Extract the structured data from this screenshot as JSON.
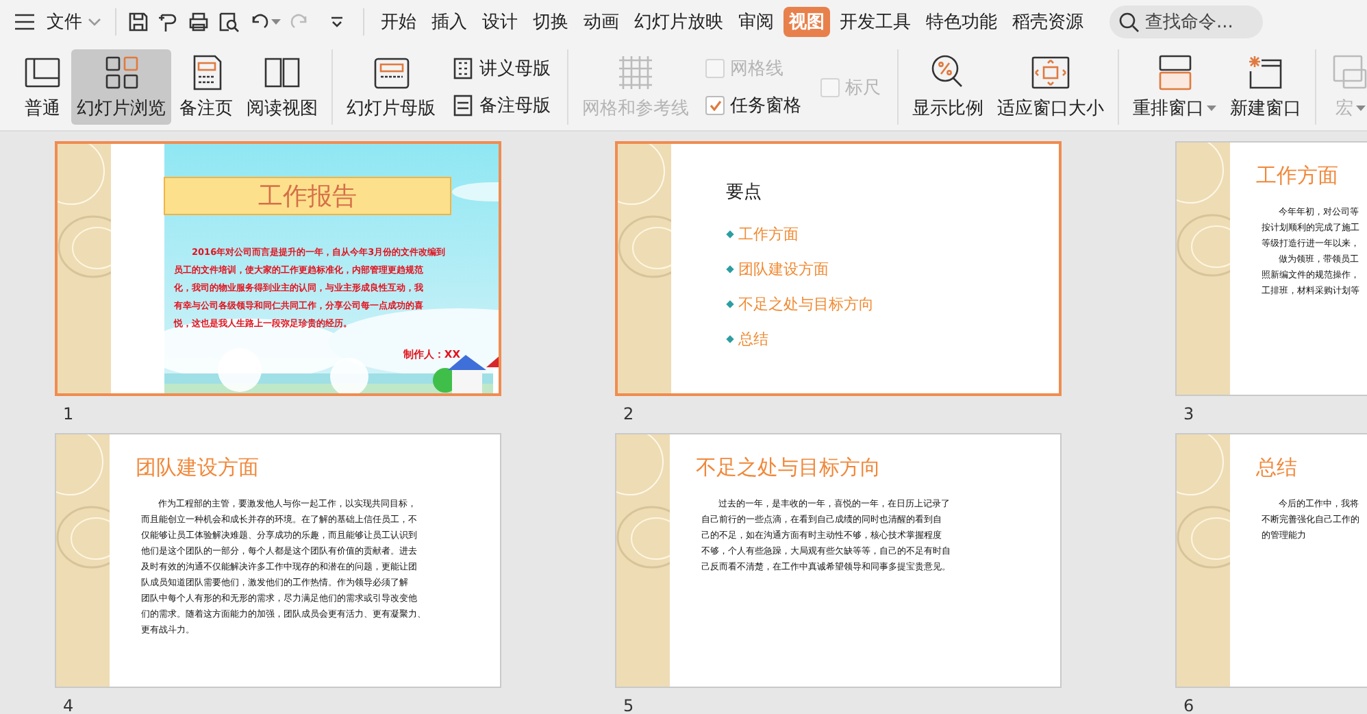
{
  "file_menu": {
    "label": "文件"
  },
  "tabs": [
    {
      "label": "开始",
      "selected": false
    },
    {
      "label": "插入",
      "selected": false
    },
    {
      "label": "设计",
      "selected": false
    },
    {
      "label": "切换",
      "selected": false
    },
    {
      "label": "动画",
      "selected": false
    },
    {
      "label": "幻灯片放映",
      "selected": false
    },
    {
      "label": "审阅",
      "selected": false
    },
    {
      "label": "视图",
      "selected": true
    },
    {
      "label": "开发工具",
      "selected": false
    },
    {
      "label": "特色功能",
      "selected": false
    },
    {
      "label": "稻壳资源",
      "selected": false
    }
  ],
  "search": {
    "placeholder": "查找命令..."
  },
  "ribbon": {
    "groups": [
      {
        "items": [
          {
            "kind": "large",
            "label": "普通",
            "selected": false,
            "disabled": false,
            "has_menu": false
          },
          {
            "kind": "large",
            "label": "幻灯片浏览",
            "selected": true,
            "disabled": false,
            "has_menu": false
          },
          {
            "kind": "large",
            "label": "备注页",
            "selected": false,
            "disabled": false,
            "has_menu": false
          },
          {
            "kind": "large",
            "label": "阅读视图",
            "selected": false,
            "disabled": false,
            "has_menu": false
          }
        ]
      },
      {
        "items": [
          {
            "kind": "large",
            "label": "幻灯片母版",
            "selected": false,
            "disabled": false,
            "has_menu": false
          },
          {
            "kind": "column",
            "items": [
              {
                "kind": "small",
                "label": "讲义母版",
                "disabled": false
              },
              {
                "kind": "small",
                "label": "备注母版",
                "disabled": false
              }
            ]
          }
        ]
      },
      {
        "items": [
          {
            "kind": "large",
            "label": "网格和参考线",
            "selected": false,
            "disabled": true,
            "has_menu": false
          },
          {
            "kind": "column",
            "items": [
              {
                "kind": "checkbox",
                "label": "网格线",
                "checked": false,
                "disabled": true
              },
              {
                "kind": "checkbox",
                "label": "任务窗格",
                "checked": true,
                "disabled": false
              }
            ]
          },
          {
            "kind": "column",
            "items": [
              {
                "kind": "checkbox",
                "label": "标尺",
                "checked": false,
                "disabled": true
              }
            ]
          }
        ]
      },
      {
        "items": [
          {
            "kind": "large",
            "label": "显示比例",
            "selected": false,
            "disabled": false,
            "has_menu": false
          },
          {
            "kind": "large",
            "label": "适应窗口大小",
            "selected": false,
            "disabled": false,
            "has_menu": false
          }
        ]
      },
      {
        "items": [
          {
            "kind": "large",
            "label": "重排窗口",
            "selected": false,
            "disabled": false,
            "has_menu": true
          },
          {
            "kind": "large",
            "label": "新建窗口",
            "selected": false,
            "disabled": false,
            "has_menu": false
          }
        ]
      },
      {
        "items": [
          {
            "kind": "large",
            "label": "宏",
            "selected": false,
            "disabled": true,
            "has_menu": true
          }
        ]
      }
    ]
  },
  "slides": [
    {
      "number": "1",
      "selected": true,
      "kind": "cover",
      "title": "工作报告",
      "body": [
        {
          "text": "2016年对公司而言是提升的一年，自从今年3月份的文件改编到",
          "indent": true
        },
        {
          "text": "员工的文件培训，使大家的工作更趋标准化，内部管理更趋规范",
          "indent": false
        },
        {
          "text": "化，我司的物业服务得到业主的认同，与业主形成良性互动，我",
          "indent": false
        },
        {
          "text": "有幸与公司各级领导和同仁共同工作，分享公司每一点成功的喜",
          "indent": false
        },
        {
          "text": "悦，这也是我人生路上一段弥足珍贵的经历。",
          "indent": false
        }
      ],
      "author": "制作人：XX"
    },
    {
      "number": "2",
      "selected": true,
      "kind": "bullets",
      "title": "要点",
      "bullets": [
        "工作方面",
        "团队建设方面",
        "不足之处与目标方向",
        "总结"
      ]
    },
    {
      "number": "3",
      "selected": false,
      "kind": "text",
      "title": "工作方面",
      "body": [
        {
          "text": "今年年初，对公司等",
          "indent": true
        },
        {
          "text": "按计划顺利的完成了施工",
          "indent": false
        },
        {
          "text": "等级打造行进一年以来，",
          "indent": false
        },
        {
          "text": "做为领班，带领员工",
          "indent": true
        },
        {
          "text": "照新编文件的规范操作，",
          "indent": false
        },
        {
          "text": "工排班，材料采购计划等",
          "indent": false
        }
      ]
    },
    {
      "number": "4",
      "selected": false,
      "kind": "text",
      "title": "团队建设方面",
      "body": [
        {
          "text": "作为工程部的主管，要激发他人与你一起工作，以实现共同目标，",
          "indent": true
        },
        {
          "text": "而且能创立一种机会和成长并存的环境。在了解的基础上信任员工，不",
          "indent": false
        },
        {
          "text": "仅能够让员工体验解决难题、分享成功的乐趣，而且能够让员工认识到",
          "indent": false
        },
        {
          "text": "他们是这个团队的一部分，每个人都是这个团队有价值的贡献者。进去",
          "indent": false
        },
        {
          "text": "及时有效的沟通不仅能解决许多工作中现存的和潜在的问题，更能让团",
          "indent": false
        },
        {
          "text": "队成员知道团队需要他们，激发他们的工作热情。作为领导必须了解",
          "indent": false
        },
        {
          "text": "团队中每个人有形的和无形的需求，尽力满足他们的需求或引导改变他",
          "indent": false
        },
        {
          "text": "们的需求。随着这方面能力的加强，团队成员会更有活力、更有凝聚力、",
          "indent": false
        },
        {
          "text": "更有战斗力。",
          "indent": false
        }
      ]
    },
    {
      "number": "5",
      "selected": false,
      "kind": "text",
      "title": "不足之处与目标方向",
      "body": [
        {
          "text": "过去的一年，是丰收的一年，喜悦的一年，在日历上记录了",
          "indent": true
        },
        {
          "text": "自己前行的一些点滴，在看到自己成绩的同时也清醒的看到自",
          "indent": false
        },
        {
          "text": "己的不足，如在沟通方面有时主动性不够，核心技术掌握程度",
          "indent": false
        },
        {
          "text": "不够，个人有些急躁，大局观有些欠缺等等，自己的不足有时自",
          "indent": false
        },
        {
          "text": "己反而看不清楚，在工作中真诚希望领导和同事多提宝贵意见。",
          "indent": false
        }
      ]
    },
    {
      "number": "6",
      "selected": false,
      "kind": "text",
      "title": "总结",
      "body": [
        {
          "text": "今后的工作中，我将",
          "indent": true
        },
        {
          "text": "不断完善强化自己工作的",
          "indent": false
        },
        {
          "text": "的管理能力",
          "indent": false
        }
      ]
    }
  ]
}
